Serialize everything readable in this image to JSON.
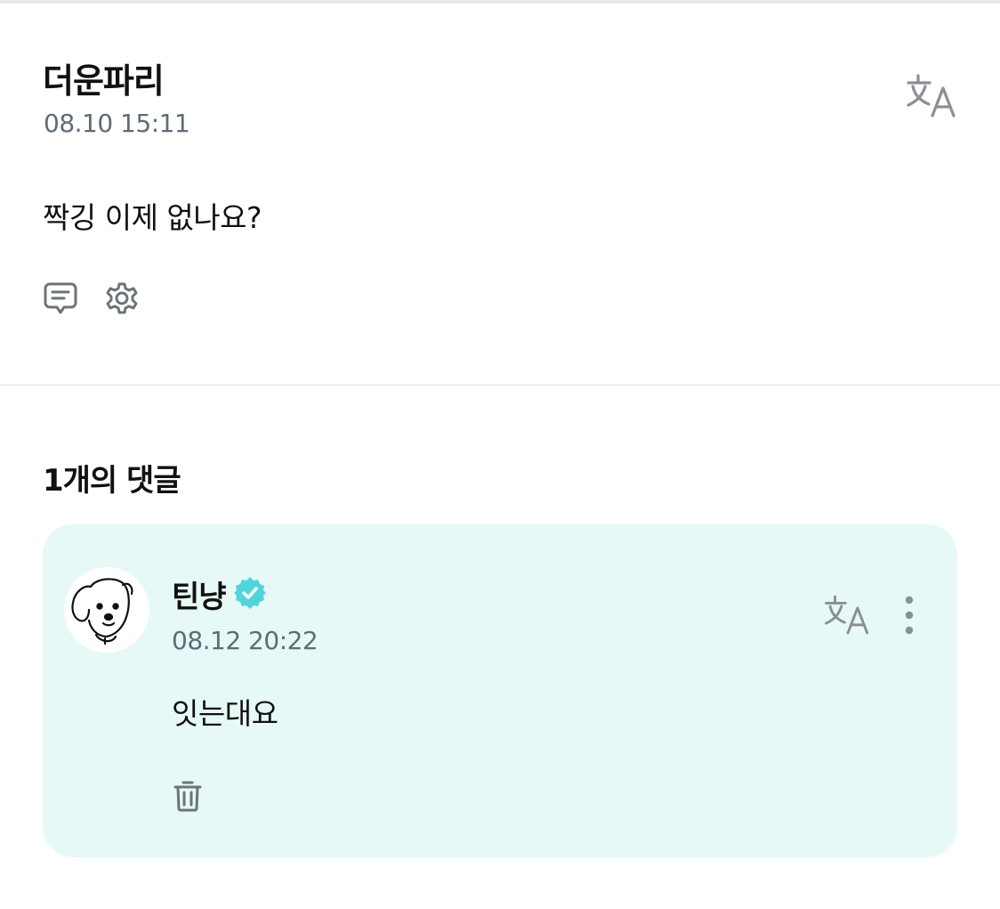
{
  "post": {
    "author": "더운파리",
    "time": "08.10 15:11",
    "body": "짝깅 이제 없나요?",
    "icons": {
      "translate": "translate-icon",
      "comment": "comment-icon",
      "settings": "gear-icon"
    }
  },
  "comments": {
    "heading": "1개의 댓글",
    "items": [
      {
        "author": "틴냥",
        "verified": true,
        "time": "08.12 20:22",
        "body": "잇는대요",
        "icons": {
          "avatar": "puppy-avatar",
          "verified": "verified-badge-icon",
          "translate": "translate-icon",
          "more": "more-vertical-icon",
          "delete": "trash-icon"
        }
      }
    ]
  },
  "colors": {
    "comment_card_bg": "#e6f9f7",
    "verified_badge": "#4fd6dc",
    "timestamp": "#5f6b78",
    "icon_gray": "#6d737b",
    "divider": "#dcdee1"
  }
}
